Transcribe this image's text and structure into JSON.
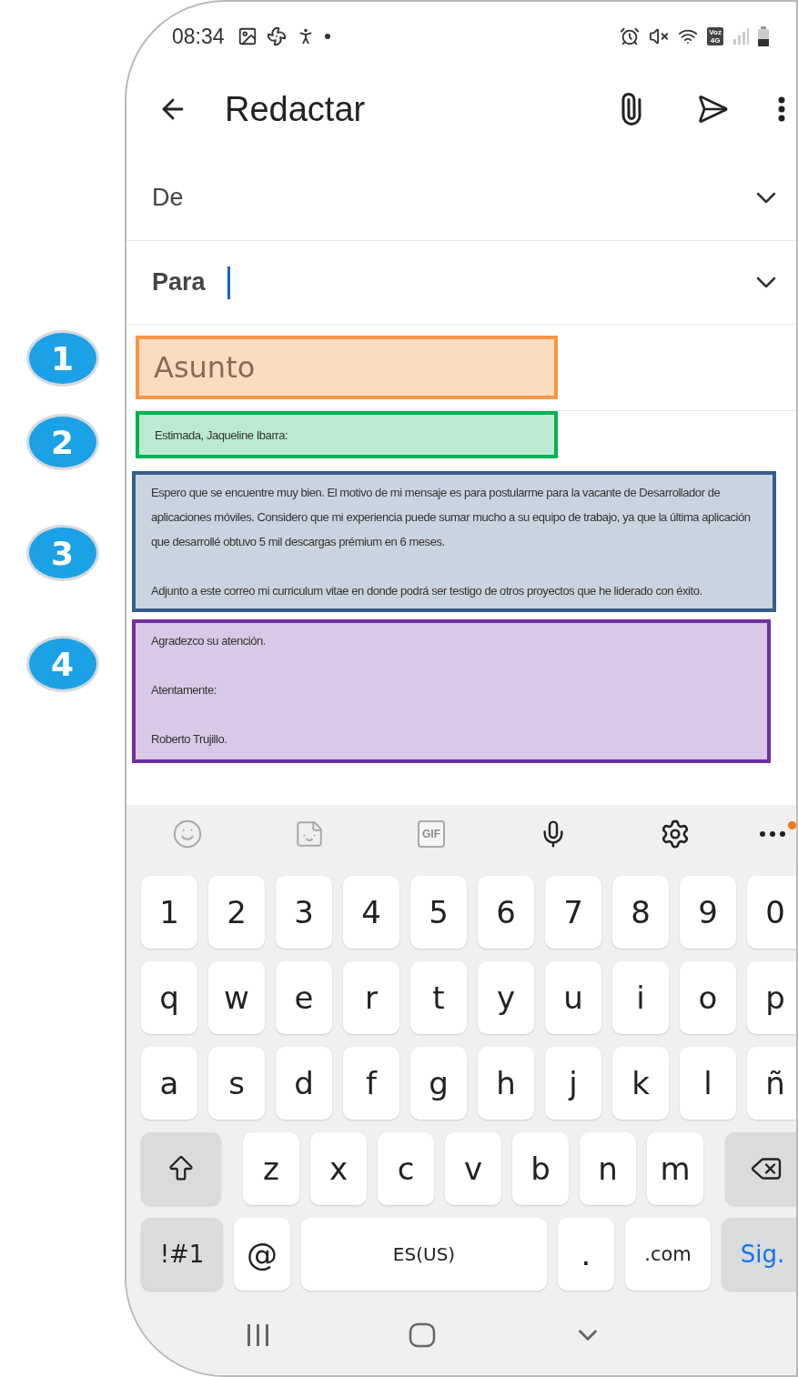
{
  "status_bar": {
    "time": "08:34",
    "network_badge": [
      "Voz",
      "4G"
    ]
  },
  "header": {
    "title": "Redactar"
  },
  "fields": [
    {
      "label": "De",
      "focused": false
    },
    {
      "label": "Para",
      "focused": true
    }
  ],
  "sections": [
    {
      "number": "1",
      "kind": "subject",
      "placeholder": "Asunto",
      "color": "#f79646"
    },
    {
      "number": "2",
      "kind": "greeting",
      "paragraphs": [
        "Estimada, Jaqueline Ibarra:"
      ],
      "color": "#00b050"
    },
    {
      "number": "3",
      "kind": "body",
      "paragraphs": [
        "Espero que se encuentre muy bien. El motivo de mi mensaje es para postularme para la vacante de Desarrollador de aplicaciones móviles. Considero que mi experiencia puede sumar mucho a su equipo de trabajo, ya que la última aplicación que desarrollé obtuvo 5 mil descargas prémium en 6 meses.",
        "Adjunto a este correo mi curriculum vitae en donde podrá ser testigo de otros proyectos que he liderado con éxito."
      ],
      "color": "#385d8a"
    },
    {
      "number": "4",
      "kind": "closing",
      "paragraphs": [
        "Agradezco su atención.",
        "Atentamente:",
        "Roberto Trujillo."
      ],
      "color": "#7030a0"
    }
  ],
  "keyboard": {
    "toolbar": [
      {
        "kind": "emoji",
        "disabled": true
      },
      {
        "kind": "sticker",
        "disabled": true
      },
      {
        "kind": "gif",
        "label": "GIF",
        "disabled": true
      },
      {
        "kind": "mic",
        "disabled": false
      },
      {
        "kind": "settings",
        "disabled": false
      },
      {
        "kind": "more",
        "disabled": false,
        "badge": true
      }
    ],
    "rows": [
      {
        "keys": [
          {
            "label": "1",
            "kind": "char"
          },
          {
            "label": "2",
            "kind": "char"
          },
          {
            "label": "3",
            "kind": "char"
          },
          {
            "label": "4",
            "kind": "char"
          },
          {
            "label": "5",
            "kind": "char"
          },
          {
            "label": "6",
            "kind": "char"
          },
          {
            "label": "7",
            "kind": "char"
          },
          {
            "label": "8",
            "kind": "char"
          },
          {
            "label": "9",
            "kind": "char"
          },
          {
            "label": "0",
            "kind": "char"
          }
        ]
      },
      {
        "keys": [
          {
            "label": "q",
            "kind": "char"
          },
          {
            "label": "w",
            "kind": "char"
          },
          {
            "label": "e",
            "kind": "char"
          },
          {
            "label": "r",
            "kind": "char"
          },
          {
            "label": "t",
            "kind": "char"
          },
          {
            "label": "y",
            "kind": "char"
          },
          {
            "label": "u",
            "kind": "char"
          },
          {
            "label": "i",
            "kind": "char"
          },
          {
            "label": "o",
            "kind": "char"
          },
          {
            "label": "p",
            "kind": "char"
          }
        ]
      },
      {
        "keys": [
          {
            "label": "a",
            "kind": "char"
          },
          {
            "label": "s",
            "kind": "char"
          },
          {
            "label": "d",
            "kind": "char"
          },
          {
            "label": "f",
            "kind": "char"
          },
          {
            "label": "g",
            "kind": "char"
          },
          {
            "label": "h",
            "kind": "char"
          },
          {
            "label": "j",
            "kind": "char"
          },
          {
            "label": "k",
            "kind": "char"
          },
          {
            "label": "l",
            "kind": "char"
          },
          {
            "label": "ñ",
            "kind": "char"
          }
        ]
      },
      {
        "keys": [
          {
            "kind": "shift"
          },
          {
            "label": "z",
            "kind": "char"
          },
          {
            "label": "x",
            "kind": "char"
          },
          {
            "label": "c",
            "kind": "char"
          },
          {
            "label": "v",
            "kind": "char"
          },
          {
            "label": "b",
            "kind": "char"
          },
          {
            "label": "n",
            "kind": "char"
          },
          {
            "label": "m",
            "kind": "char"
          },
          {
            "kind": "backspace"
          }
        ]
      },
      {
        "keys": [
          {
            "label": "!#1",
            "kind": "mod"
          },
          {
            "label": "@",
            "kind": "char"
          },
          {
            "label": "ES(US)",
            "kind": "space"
          },
          {
            "label": ".",
            "kind": "char"
          },
          {
            "label": ".com",
            "kind": "small"
          },
          {
            "label": "Sig.",
            "kind": "action"
          }
        ]
      }
    ]
  }
}
